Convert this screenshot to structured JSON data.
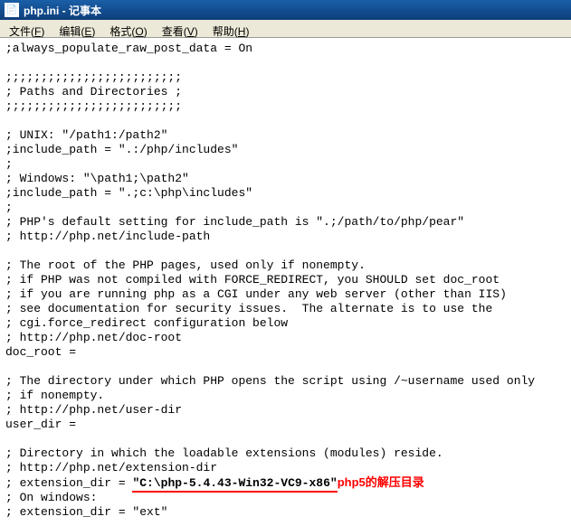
{
  "titlebar": {
    "filename": "php.ini",
    "separator": " - ",
    "appname": "记事本"
  },
  "menubar": {
    "file": {
      "label": "文件",
      "hotkey": "F"
    },
    "edit": {
      "label": "编辑",
      "hotkey": "E"
    },
    "format": {
      "label": "格式",
      "hotkey": "O"
    },
    "view": {
      "label": "查看",
      "hotkey": "V"
    },
    "help": {
      "label": "帮助",
      "hotkey": "H"
    }
  },
  "content": {
    "lines": [
      ";always_populate_raw_post_data = On",
      "",
      ";;;;;;;;;;;;;;;;;;;;;;;;;",
      "; Paths and Directories ;",
      ";;;;;;;;;;;;;;;;;;;;;;;;;",
      "",
      "; UNIX: \"/path1:/path2\"",
      ";include_path = \".:/php/includes\"",
      ";",
      "; Windows: \"\\path1;\\path2\"",
      ";include_path = \".;c:\\php\\includes\"",
      ";",
      "; PHP's default setting for include_path is \".;/path/to/php/pear\"",
      "; http://php.net/include-path",
      "",
      "; The root of the PHP pages, used only if nonempty.",
      "; if PHP was not compiled with FORCE_REDIRECT, you SHOULD set doc_root",
      "; if you are running php as a CGI under any web server (other than IIS)",
      "; see documentation for security issues.  The alternate is to use the",
      "; cgi.force_redirect configuration below",
      "; http://php.net/doc-root",
      "doc_root =",
      "",
      "; The directory under which PHP opens the script using /~username used only",
      "; if nonempty.",
      "; http://php.net/user-dir",
      "user_dir =",
      "",
      "; Directory in which the loadable extensions (modules) reside.",
      "; http://php.net/extension-dir"
    ],
    "highlighted_line": {
      "prefix": "; extension_dir = ",
      "path": "\"C:\\php-5.4.43-Win32-VC9-x86\"",
      "annotation": "php5的解压目录"
    },
    "after_lines": [
      "; On windows:",
      "; extension_dir = \"ext\""
    ]
  }
}
